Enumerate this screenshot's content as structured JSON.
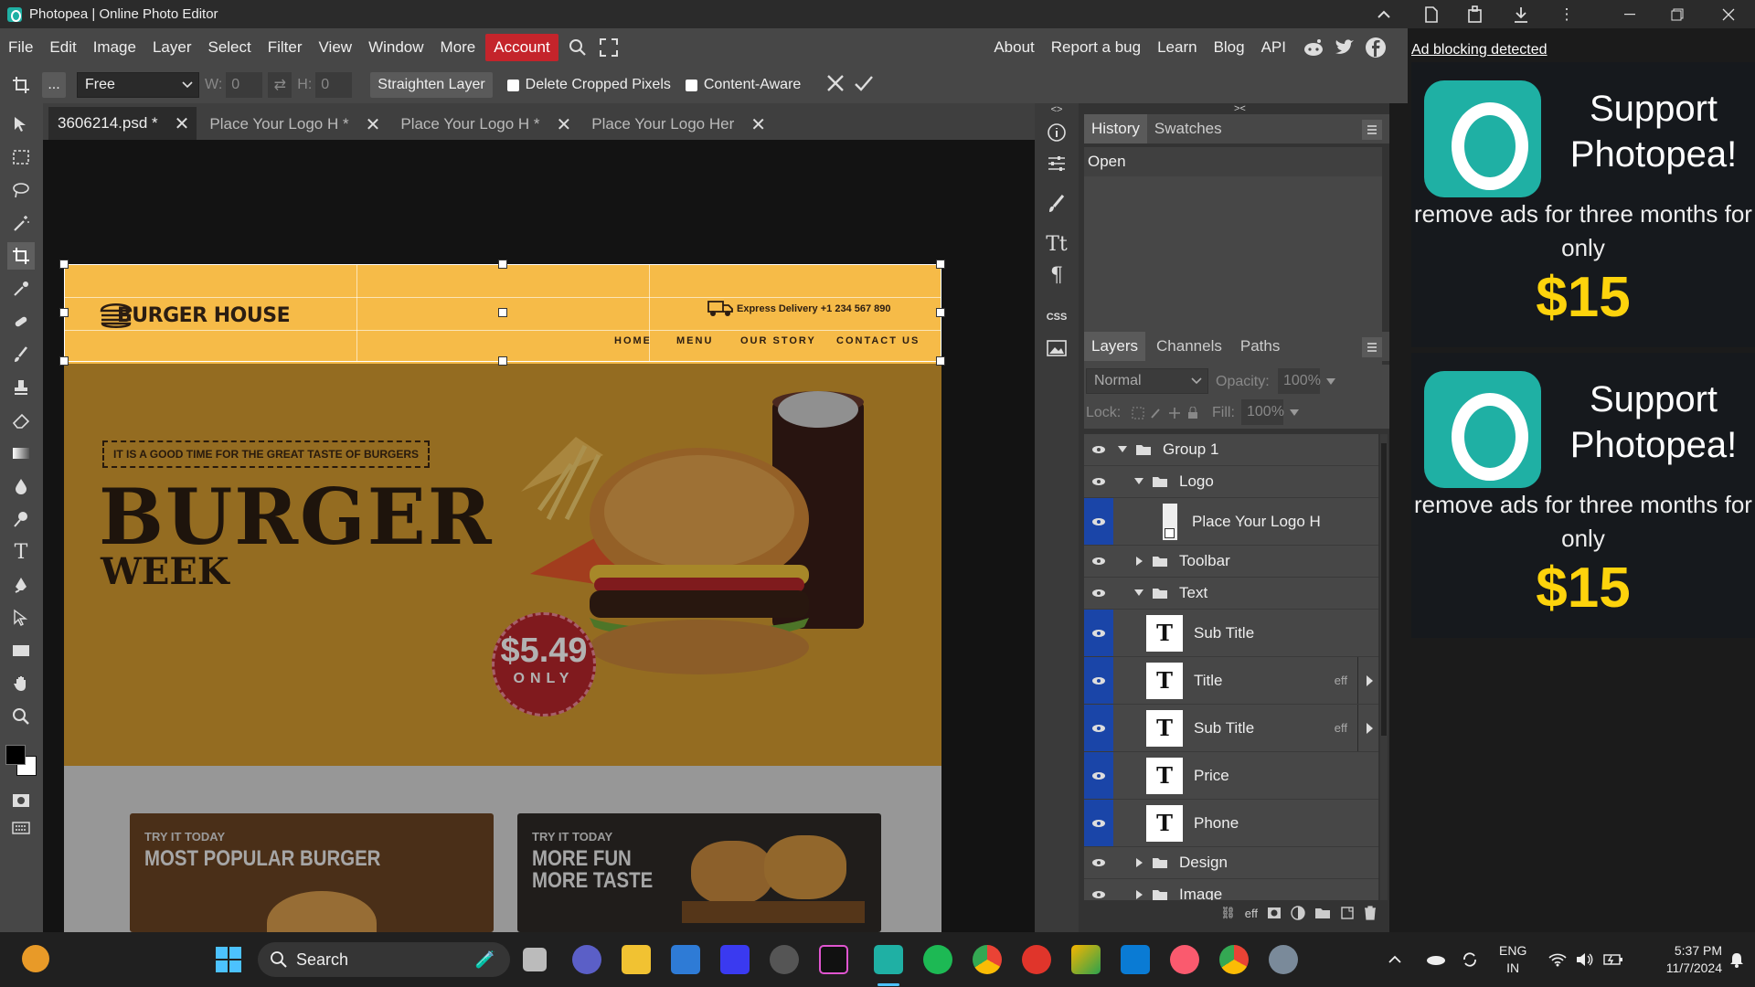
{
  "window": {
    "title": "Photopea | Online Photo Editor"
  },
  "menu": {
    "items": [
      "File",
      "Edit",
      "Image",
      "Layer",
      "Select",
      "Filter",
      "View",
      "Window",
      "More"
    ],
    "account": "Account",
    "right": [
      "About",
      "Report a bug",
      "Learn",
      "Blog",
      "API"
    ],
    "ad_notice": "Ad blocking detected"
  },
  "options": {
    "more": "...",
    "mode": "Free",
    "w_label": "W:",
    "w_value": "0",
    "h_label": "H:",
    "h_value": "0",
    "straighten": "Straighten Layer",
    "delete_cropped": "Delete Cropped Pixels",
    "content_aware": "Content-Aware"
  },
  "tabs": [
    {
      "label": "3606214.psd *",
      "active": true
    },
    {
      "label": "Place Your Logo H *",
      "active": false
    },
    {
      "label": "Place Your Logo H *",
      "active": false
    },
    {
      "label": "Place Your Logo Her",
      "active": false
    }
  ],
  "document": {
    "brand": "BURGER HOUSE",
    "delivery": "Express Delivery +1 234 567 890",
    "nav": [
      "HOME",
      "MENU",
      "OUR STORY",
      "CONTACT US"
    ],
    "tagline": "IT IS A GOOD TIME FOR THE GREAT TASTE OF BURGERS",
    "title": "BURGER",
    "subtitle": "WEEK",
    "price": "$5.49",
    "price_sub": "ONLY",
    "card1_small": "TRY IT TODAY",
    "card1_big": "MOST POPULAR BURGER",
    "card2_small": "TRY IT TODAY",
    "card2_big_line1": "MORE FUN",
    "card2_big_line2": "MORE TASTE"
  },
  "panels": {
    "top_tabs": [
      "History",
      "Swatches"
    ],
    "history": [
      "Open"
    ],
    "layer_tabs": [
      "Layers",
      "Channels",
      "Paths"
    ],
    "blend_mode": "Normal",
    "opacity_label": "Opacity:",
    "opacity": "100%",
    "lock_label": "Lock:",
    "fill_label": "Fill:",
    "fill": "100%",
    "eff_label": "eff",
    "layers": [
      {
        "name": "Group 1",
        "type": "group",
        "depth": 0,
        "open": true
      },
      {
        "name": "Logo",
        "type": "group",
        "depth": 1,
        "open": true
      },
      {
        "name": "Place Your Logo H",
        "type": "smart",
        "depth": 2,
        "selected": true
      },
      {
        "name": "Toolbar",
        "type": "group",
        "depth": 1,
        "open": false
      },
      {
        "name": "Text",
        "type": "group",
        "depth": 1,
        "open": true
      },
      {
        "name": "Sub Title",
        "type": "text",
        "depth": 2,
        "selected": true
      },
      {
        "name": "Title",
        "type": "text",
        "depth": 2,
        "selected": true,
        "eff": true
      },
      {
        "name": "Sub Title",
        "type": "text",
        "depth": 2,
        "selected": true,
        "eff": true
      },
      {
        "name": "Price",
        "type": "text",
        "depth": 2,
        "selected": true
      },
      {
        "name": "Phone",
        "type": "text",
        "depth": 2,
        "selected": true
      },
      {
        "name": "Design",
        "type": "group",
        "depth": 1,
        "open": false
      },
      {
        "name": "Image",
        "type": "group",
        "depth": 1,
        "open": false
      }
    ]
  },
  "ads": [
    {
      "headline": "Support Photopea!",
      "sub": "remove ads for three months for only",
      "price": "$15"
    },
    {
      "headline": "Support Photopea!",
      "sub": "remove ads for three months for only",
      "price": "$15"
    }
  ],
  "taskbar": {
    "search": "Search",
    "lang1": "ENG",
    "lang2": "IN",
    "time": "5:37 PM",
    "date": "11/7/2024"
  },
  "colors": {
    "accent": "#c4242b",
    "photopea": "#1fb0a4",
    "selected_layer": "#1a45a8",
    "ad_price": "#fdd30c"
  }
}
